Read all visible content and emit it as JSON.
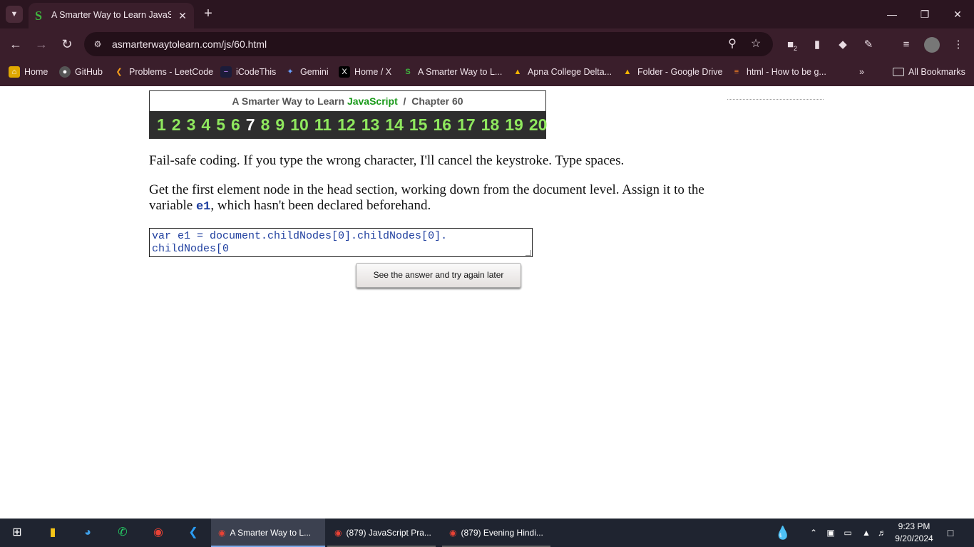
{
  "browser": {
    "tab_title": "A Smarter Way to Learn JavaScript",
    "url": "asmarterwaytolearn.com/js/60.html",
    "bookmarks": [
      {
        "label": "Home",
        "icon": "home-icon"
      },
      {
        "label": "GitHub",
        "icon": "github-icon"
      },
      {
        "label": "Problems - LeetCode",
        "icon": "leetcode-icon"
      },
      {
        "label": "iCodeThis",
        "icon": "icodethis-icon"
      },
      {
        "label": "Gemini",
        "icon": "gemini-icon"
      },
      {
        "label": "Home / X",
        "icon": "x-icon"
      },
      {
        "label": "A Smarter Way to L...",
        "icon": "smarterway-icon"
      },
      {
        "label": "Apna College Delta...",
        "icon": "drive-icon"
      },
      {
        "label": "Folder - Google Drive",
        "icon": "drive-icon"
      },
      {
        "label": "html - How to be g...",
        "icon": "stackoverflow-icon"
      }
    ],
    "all_bookmarks": "All Bookmarks",
    "extension_badge": "2"
  },
  "page": {
    "header_prefix": "A Smarter Way to Learn ",
    "header_js": "JavaScript",
    "header_suffix": "  /  Chapter 60",
    "numbers": [
      "1",
      "2",
      "3",
      "4",
      "5",
      "6",
      "7",
      "8",
      "9",
      "10",
      "11",
      "12",
      "13",
      "14",
      "15",
      "16",
      "17",
      "18",
      "19",
      "20"
    ],
    "current_number": "7",
    "intro": "Fail-safe coding. If you type the wrong character, I'll cancel the keystroke. Type spaces.",
    "task_before": "Get the first element node in the head section, working down from the document level. Assign it to the variable ",
    "task_var": "e1",
    "task_after": ", which hasn't been declared beforehand.",
    "code_value": "var e1 = document.childNodes[0].childNodes[0].\nchildNodes[0",
    "answer_button": "See the answer and try again later"
  },
  "taskbar": {
    "apps": [
      {
        "label": "A Smarter Way to L..."
      },
      {
        "label": "(879) JavaScript Pra..."
      },
      {
        "label": "(879) Evening Hindi..."
      }
    ],
    "time": "9:23 PM",
    "date": "9/20/2024"
  },
  "colors": {
    "chrome_bg": "#3a1e2b",
    "number_green": "#8fe85e",
    "code_blue": "#1f3f9f",
    "javascript_green": "#1a9a1a"
  }
}
